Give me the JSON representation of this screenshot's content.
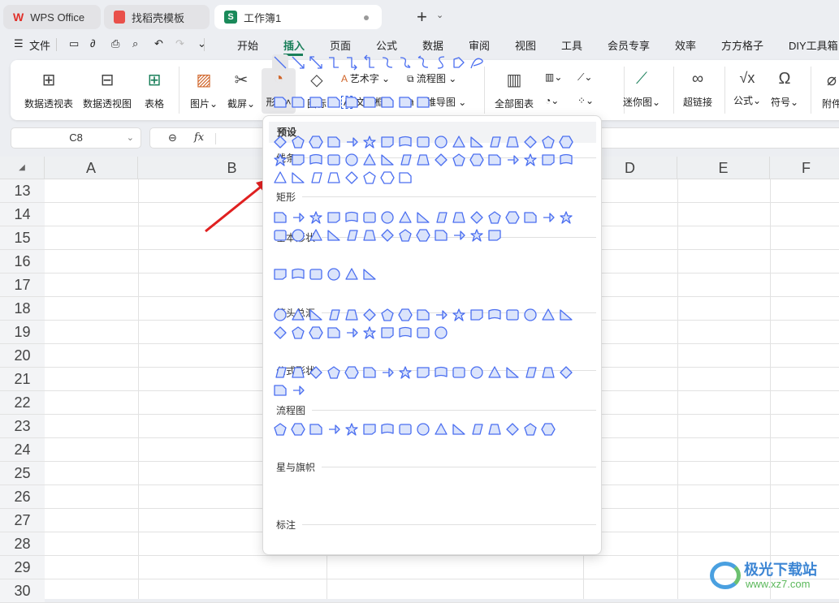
{
  "tabs": [
    {
      "label": "WPS Office"
    },
    {
      "label": "找稻壳模板"
    },
    {
      "label": "工作簿1"
    }
  ],
  "menubar": {
    "file": "文件",
    "items": [
      "开始",
      "插入",
      "页面",
      "公式",
      "数据",
      "审阅",
      "视图",
      "工具",
      "会员专享",
      "效率",
      "方方格子",
      "DIY工具箱"
    ],
    "active": "插入"
  },
  "ribbon": {
    "pivot_table": "数据透视表",
    "pivot_chart": "数据透视图",
    "table": "表格",
    "picture": "图片",
    "screenshot": "截屏",
    "shapes": "形状",
    "icons": "图标",
    "wordart": "艺术字",
    "textbox": "文本框",
    "flowchart": "流程图",
    "mindmap": "思维导图",
    "all_charts": "全部图表",
    "sparkline": "迷你图",
    "hyperlink": "超链接",
    "formula": "公式",
    "symbol": "符号",
    "attachment": "附件"
  },
  "formula_bar": {
    "cell_ref": "C8",
    "fx": "fx",
    "value": ""
  },
  "columns": [
    "A",
    "B",
    "D",
    "E",
    "F"
  ],
  "rows": [
    "13",
    "14",
    "15",
    "16",
    "17",
    "18",
    "19",
    "20",
    "21",
    "22",
    "23",
    "24",
    "25",
    "26",
    "27",
    "28",
    "29",
    "30"
  ],
  "shapes_popup": {
    "header": "预设",
    "sections": [
      "线条",
      "矩形",
      "基本形状",
      "箭头总汇",
      "公式形状",
      "流程图",
      "星与旗帜",
      "标注"
    ]
  },
  "watermark": {
    "name": "极光下载站",
    "url": "www.xz7.com"
  },
  "colors": {
    "accent": "#1a7f5a",
    "shape_stroke": "#4a6ef0",
    "shape_fill": "#dbe4fb",
    "arrow": "#e02020"
  }
}
